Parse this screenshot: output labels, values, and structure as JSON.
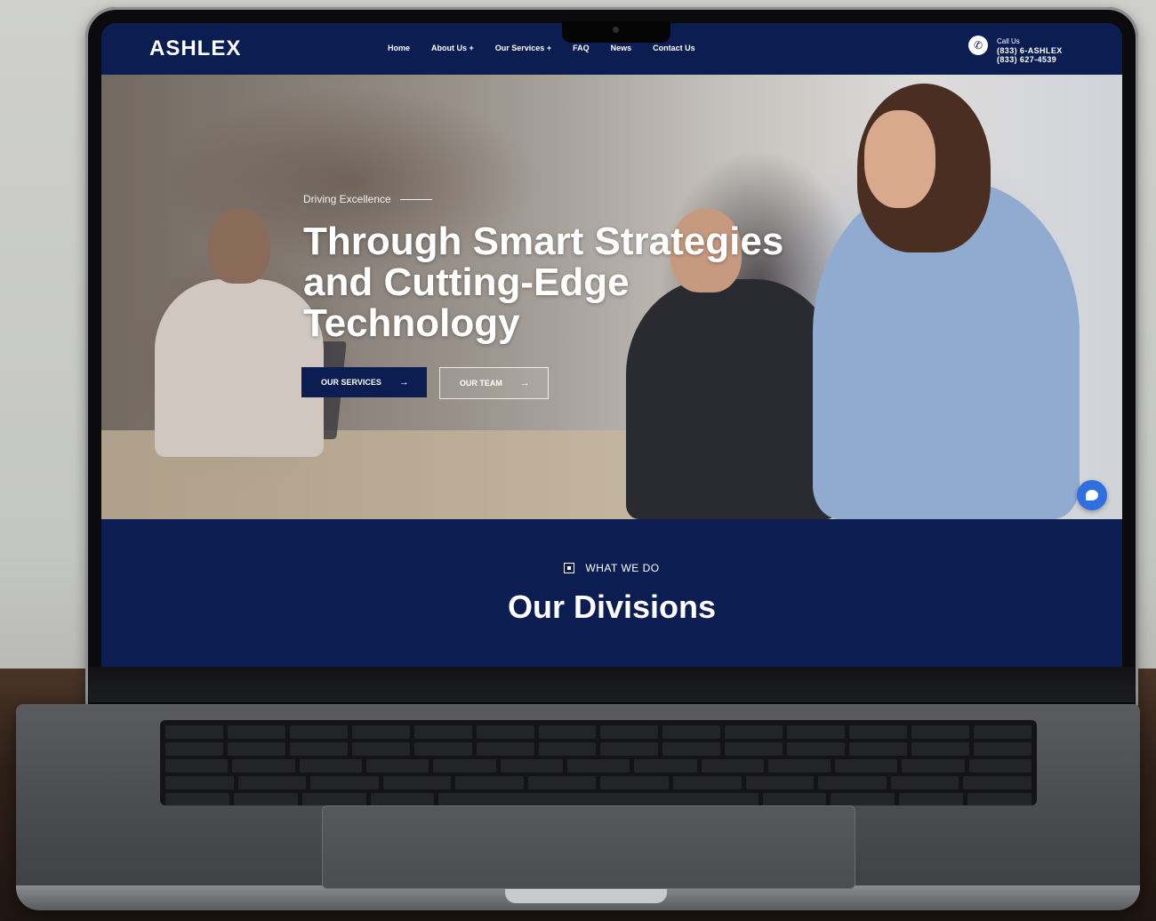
{
  "header": {
    "logo": "ASHLEX",
    "menu": [
      "Home",
      "About Us +",
      "Our Services +",
      "FAQ",
      "News",
      "Contact Us"
    ],
    "call_label": "Call Us",
    "phone_vanity": "(833) 6-ASHLEX",
    "phone_number": "(833) 627-4539"
  },
  "hero": {
    "eyebrow": "Driving Excellence",
    "headline": "Through Smart Strategies and Cutting-Edge Technology",
    "primary_button": "OUR SERVICES",
    "secondary_button": "OUR TEAM",
    "arrow": "→"
  },
  "divisions": {
    "tag": "WHAT WE DO",
    "title": "Our Divisions"
  },
  "colors": {
    "brand_navy": "#0c1d52",
    "chat_blue": "#2f6fe0"
  },
  "icons": {
    "phone": "phone-icon",
    "chat": "chat-icon",
    "arrow": "arrow-right-icon"
  }
}
